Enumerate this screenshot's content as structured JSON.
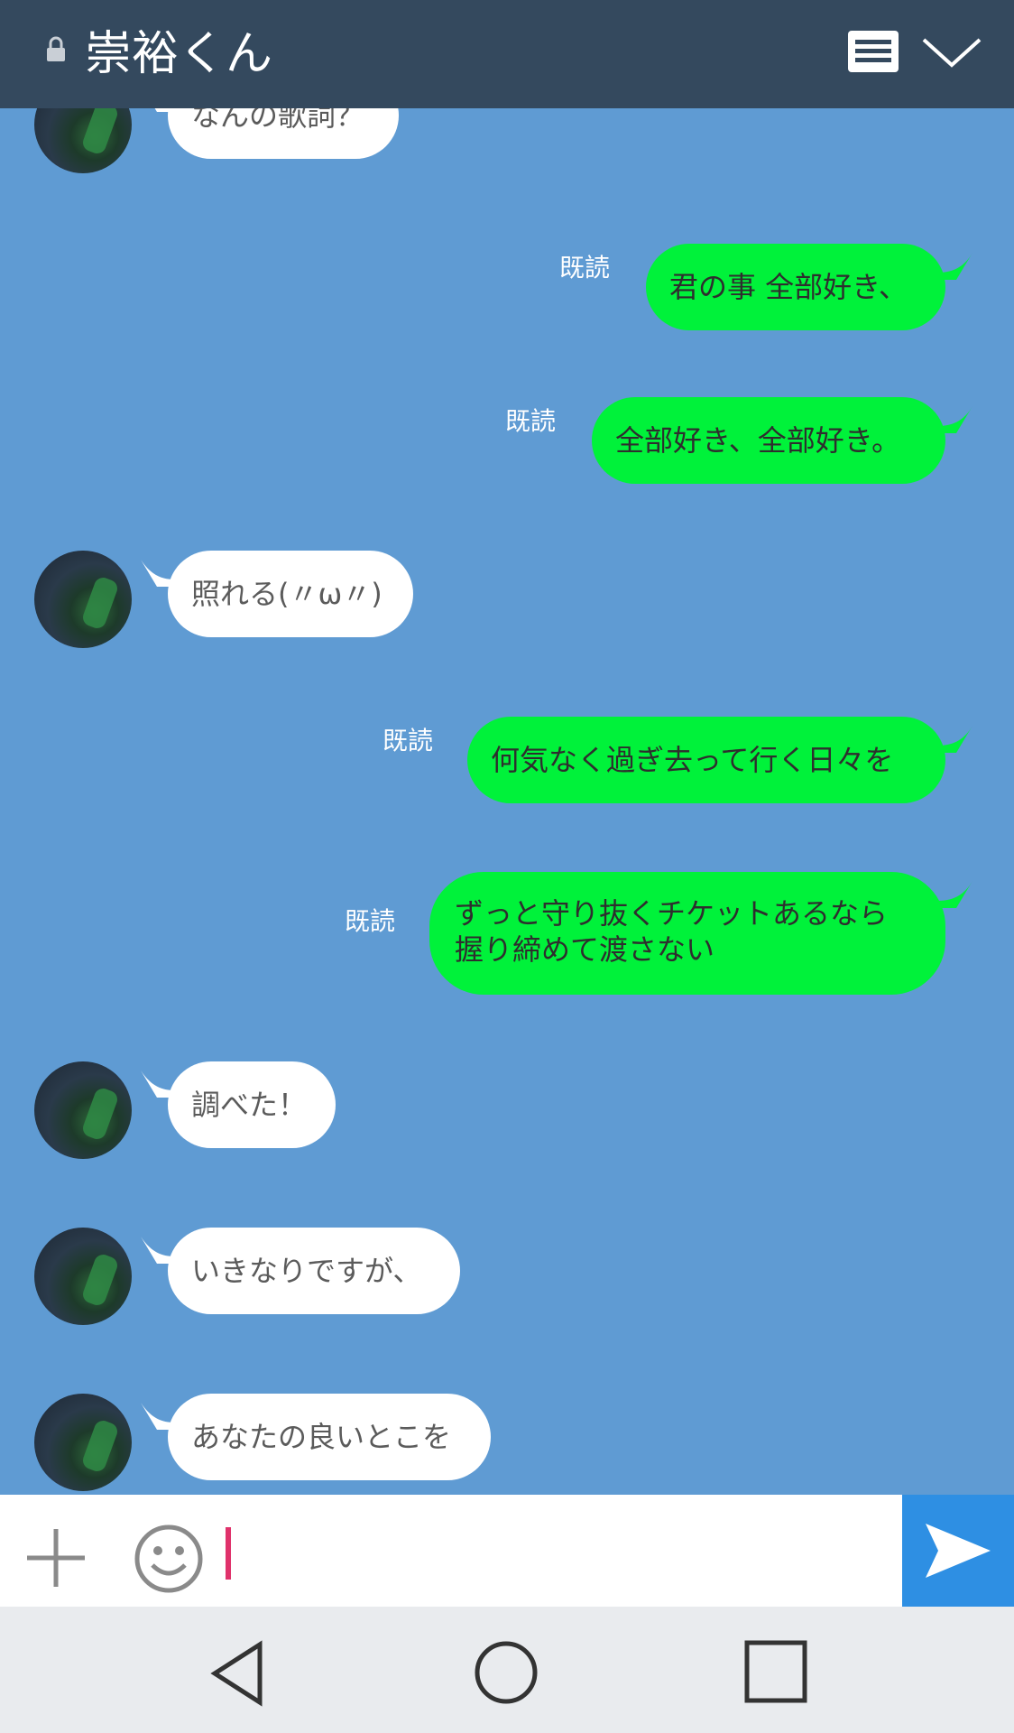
{
  "header": {
    "title": "崇裕くん"
  },
  "messages": [
    {
      "side": "in",
      "text": "なんの歌詞？"
    },
    {
      "side": "out",
      "text": "君の事 全部好き、",
      "status": "既読"
    },
    {
      "side": "out",
      "text": "全部好き、全部好き。",
      "status": "既読"
    },
    {
      "side": "in",
      "text": "照れる(〃ω〃)"
    },
    {
      "side": "out",
      "text": "何気なく過ぎ去って行く日々を",
      "status": "既読"
    },
    {
      "side": "out",
      "lines": [
        "ずっと守り抜くチケットあるなら",
        "握り締めて渡さない"
      ],
      "status": "既読"
    },
    {
      "side": "in",
      "text": "調べた！"
    },
    {
      "side": "in",
      "text": "いきなりですが、"
    },
    {
      "side": "in",
      "text": "あなたの良いとこを"
    }
  ],
  "colors": {
    "header_bg": "#34495e",
    "chat_bg": "#5f9bd3",
    "outgoing_bubble": "#00f23a",
    "incoming_bubble": "#ffffff",
    "send_button": "#2e8fe3",
    "cursor": "#e0326b"
  },
  "icons": {
    "lock": "lock-icon",
    "menu": "menu-icon",
    "collapse": "chevron-down-icon",
    "add": "plus-icon",
    "emoji": "smile-icon",
    "send": "send-icon",
    "back": "back-icon",
    "home": "home-icon",
    "recents": "recents-icon"
  }
}
